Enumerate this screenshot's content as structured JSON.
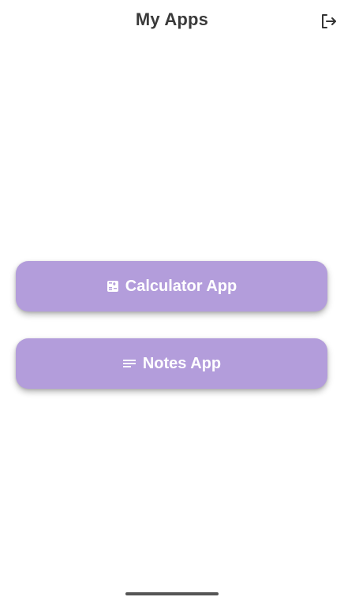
{
  "app_bar": {
    "title": "My Apps",
    "logout_icon": "logout-icon"
  },
  "buttons": [
    {
      "label": "Calculator App",
      "icon": "calculator-icon"
    },
    {
      "label": "Notes App",
      "icon": "notes-lines-icon"
    }
  ],
  "colors": {
    "button_bg": "#b39ddb",
    "button_text": "#ffffff",
    "title_text": "#3a3a3a"
  }
}
